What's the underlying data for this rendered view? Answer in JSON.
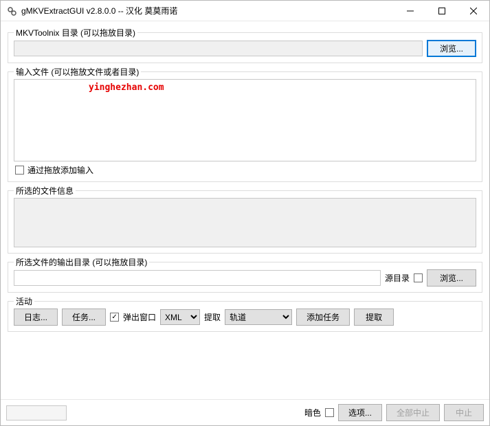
{
  "window": {
    "title": "gMKVExtractGUI v2.8.0.0 -- 汉化 莫莫雨诺"
  },
  "mkvtoolnix": {
    "group_label": "MKVToolnix 目录 (可以拖放目录)",
    "path_value": "",
    "browse_label": "浏览..."
  },
  "input": {
    "group_label": "输入文件 (可以拖放文件或者目录)",
    "watermark": "yinghezhan.com",
    "add_by_drag_label": "通过拖放添加输入",
    "add_by_drag_checked": false
  },
  "fileinfo": {
    "group_label": "所选的文件信息"
  },
  "output": {
    "group_label": "所选文件的输出目录 (可以拖放目录)",
    "path_value": "",
    "source_dir_label": "源目录",
    "source_dir_checked": false,
    "browse_label": "浏览..."
  },
  "activity": {
    "group_label": "活动",
    "log_label": "日志...",
    "tasks_label": "任务...",
    "popup_label": "弹出窗口",
    "popup_checked": true,
    "xml_selected": "XML",
    "extract_label": "提取",
    "track_selected": "轨道",
    "add_task_label": "添加任务",
    "extract_btn_label": "提取"
  },
  "footer": {
    "dark_label": "暗色",
    "dark_checked": false,
    "options_label": "选项...",
    "abort_all_label": "全部中止",
    "abort_label": "中止"
  }
}
